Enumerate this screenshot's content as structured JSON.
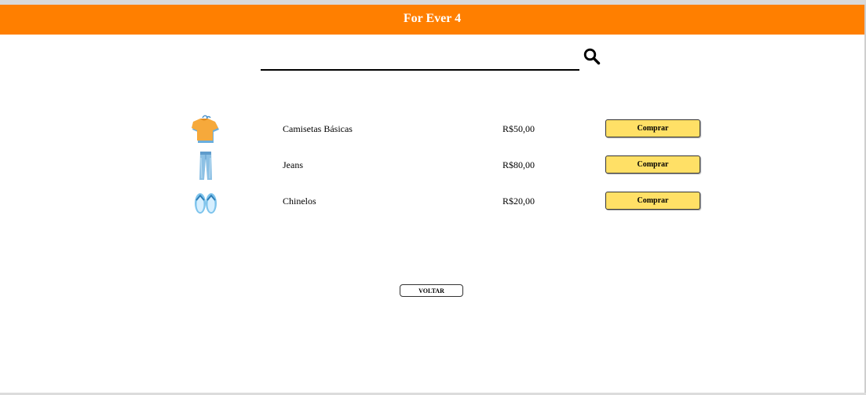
{
  "header": {
    "title": "For Ever 4",
    "background_color": "#ff7f00"
  },
  "search": {
    "value": "",
    "icon": "search-icon"
  },
  "products": [
    {
      "name": "Camisetas Básicas",
      "price": "R$50,00",
      "button_label": "Comprar",
      "icon": "tshirt-icon"
    },
    {
      "name": "Jeans",
      "price": "R$80,00",
      "button_label": "Comprar",
      "icon": "jeans-icon"
    },
    {
      "name": "Chinelos",
      "price": "R$20,00",
      "button_label": "Comprar",
      "icon": "flip-flops-icon"
    }
  ],
  "buy_button_color": "#ffe066",
  "back_button": {
    "label": "VOLTAR"
  }
}
